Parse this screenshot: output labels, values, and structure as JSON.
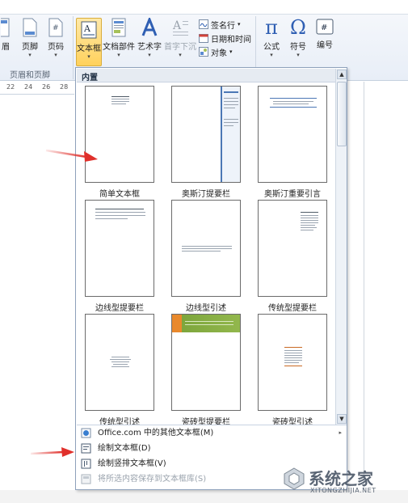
{
  "ribbon": {
    "partial_left_label": "眉",
    "footer_label": "页脚",
    "page_number_label": "页码",
    "group_label": "页眉和页脚",
    "text_box_label": "文本框",
    "quick_parts_label": "文档部件",
    "wordart_label": "艺术字",
    "dropcap_label": "首字下沉",
    "signature_line_label": "签名行",
    "date_time_label": "日期和时间",
    "object_label": "对象",
    "equation_label": "公式",
    "symbol_label": "符号",
    "numbering_label": "编号",
    "pi_glyph": "π",
    "omega_glyph": "Ω",
    "hash_glyph": "#",
    "dropdown_glyph": "▾"
  },
  "ruler": {
    "ticks": [
      "22",
      "24",
      "26",
      "28"
    ]
  },
  "gallery": {
    "header": "内置",
    "tiles": [
      {
        "caption": "简单文本框",
        "style": "simple"
      },
      {
        "caption": "奥斯汀提要栏",
        "style": "austin-sidebar"
      },
      {
        "caption": "奥斯汀重要引言",
        "style": "austin-quote"
      },
      {
        "caption": "边线型提要栏",
        "style": "border-sidebar"
      },
      {
        "caption": "边线型引述",
        "style": "border-quote"
      },
      {
        "caption": "传统型提要栏",
        "style": "traditional-sidebar"
      },
      {
        "caption": "传统型引述",
        "style": "traditional-quote"
      },
      {
        "caption": "瓷砖型提要栏",
        "style": "tile-sidebar"
      },
      {
        "caption": "瓷砖型引述",
        "style": "tile-quote"
      }
    ]
  },
  "menu": {
    "more_from_office": "Office.com 中的其他文本框(M)",
    "draw_text_box": "绘制文本框(D)",
    "draw_vertical_text_box": "绘制竖排文本框(V)",
    "save_selection": "将所选内容保存到文本框库(S)",
    "submenu_glyph": "▸"
  },
  "watermark": {
    "brand": "系统之家",
    "url": "XITONGZHIJIA.NET"
  },
  "colors": {
    "annotation_arrow": "#e0302b",
    "active_button": "#ffd15c",
    "panel_border": "#8ea1bb"
  }
}
